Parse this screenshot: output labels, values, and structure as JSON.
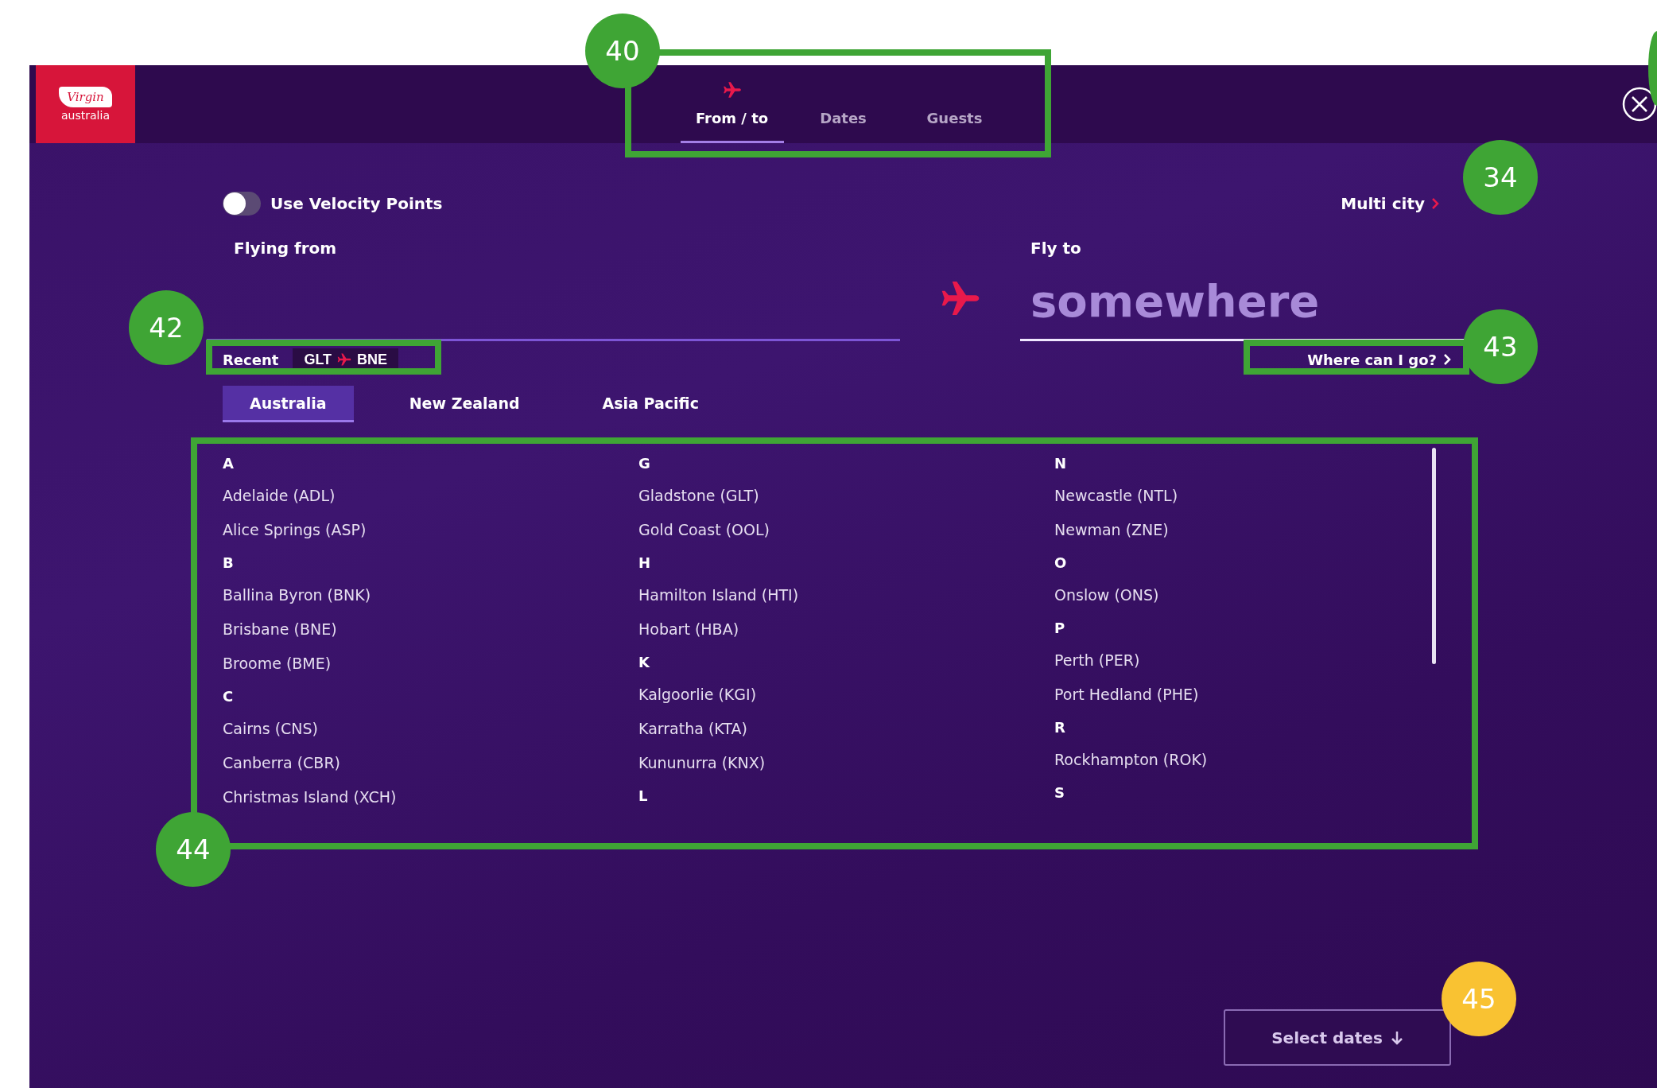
{
  "header": {
    "logo": {
      "brand": "Virgin",
      "sub": "australia"
    },
    "tabs": [
      {
        "label": "From / to",
        "selected": true
      },
      {
        "label": "Dates",
        "selected": false
      },
      {
        "label": "Guests",
        "selected": false
      }
    ]
  },
  "velocity_toggle": {
    "label": "Use Velocity Points",
    "on": false
  },
  "multi_city": {
    "label": "Multi city"
  },
  "flying_from": {
    "label": "Flying from"
  },
  "fly_to": {
    "label": "Fly to",
    "placeholder": "somewhere"
  },
  "recent": {
    "label": "Recent",
    "routes": [
      {
        "from": "GLT",
        "to": "BNE"
      }
    ]
  },
  "where_can_i_go": {
    "label": "Where can I go?"
  },
  "regions": [
    {
      "label": "Australia",
      "selected": true
    },
    {
      "label": "New Zealand",
      "selected": false
    },
    {
      "label": "Asia Pacific",
      "selected": false
    }
  ],
  "airport_columns": [
    [
      {
        "kind": "letter",
        "text": "A"
      },
      {
        "kind": "airport",
        "text": "Adelaide (ADL)"
      },
      {
        "kind": "airport",
        "text": "Alice Springs (ASP)"
      },
      {
        "kind": "letter",
        "text": "B"
      },
      {
        "kind": "airport",
        "text": "Ballina Byron (BNK)"
      },
      {
        "kind": "airport",
        "text": "Brisbane (BNE)"
      },
      {
        "kind": "airport",
        "text": "Broome (BME)"
      },
      {
        "kind": "letter",
        "text": "C"
      },
      {
        "kind": "airport",
        "text": "Cairns (CNS)"
      },
      {
        "kind": "airport",
        "text": "Canberra (CBR)"
      },
      {
        "kind": "airport",
        "text": "Christmas Island (XCH)"
      }
    ],
    [
      {
        "kind": "letter",
        "text": "G"
      },
      {
        "kind": "airport",
        "text": "Gladstone (GLT)"
      },
      {
        "kind": "airport",
        "text": "Gold Coast (OOL)"
      },
      {
        "kind": "letter",
        "text": "H"
      },
      {
        "kind": "airport",
        "text": "Hamilton Island (HTI)"
      },
      {
        "kind": "airport",
        "text": "Hobart (HBA)"
      },
      {
        "kind": "letter",
        "text": "K"
      },
      {
        "kind": "airport",
        "text": "Kalgoorlie (KGI)"
      },
      {
        "kind": "airport",
        "text": "Karratha (KTA)"
      },
      {
        "kind": "airport",
        "text": "Kununurra (KNX)"
      },
      {
        "kind": "letter",
        "text": "L"
      }
    ],
    [
      {
        "kind": "letter",
        "text": "N"
      },
      {
        "kind": "airport",
        "text": "Newcastle (NTL)"
      },
      {
        "kind": "airport",
        "text": "Newman (ZNE)"
      },
      {
        "kind": "letter",
        "text": "O"
      },
      {
        "kind": "airport",
        "text": "Onslow (ONS)"
      },
      {
        "kind": "letter",
        "text": "P"
      },
      {
        "kind": "airport",
        "text": "Perth (PER)"
      },
      {
        "kind": "airport",
        "text": "Port Hedland (PHE)"
      },
      {
        "kind": "letter",
        "text": "R"
      },
      {
        "kind": "airport",
        "text": "Rockhampton (ROK)"
      },
      {
        "kind": "letter",
        "text": "S"
      }
    ]
  ],
  "select_dates": {
    "label": "Select dates"
  },
  "annotations": [
    {
      "label": "40",
      "color": "#3fa535",
      "framed": true
    },
    {
      "color": "#3fa535",
      "framed": false
    },
    {
      "label": "34",
      "color": "#3fa535",
      "framed": false
    },
    {
      "label": "42",
      "color": "#3fa535",
      "framed": true
    },
    {
      "label": "43",
      "color": "#3fa535",
      "framed": true
    },
    {
      "label": "44",
      "color": "#3fa535",
      "framed": true
    },
    {
      "label": "45",
      "color": "#f9c232",
      "framed": false
    }
  ]
}
